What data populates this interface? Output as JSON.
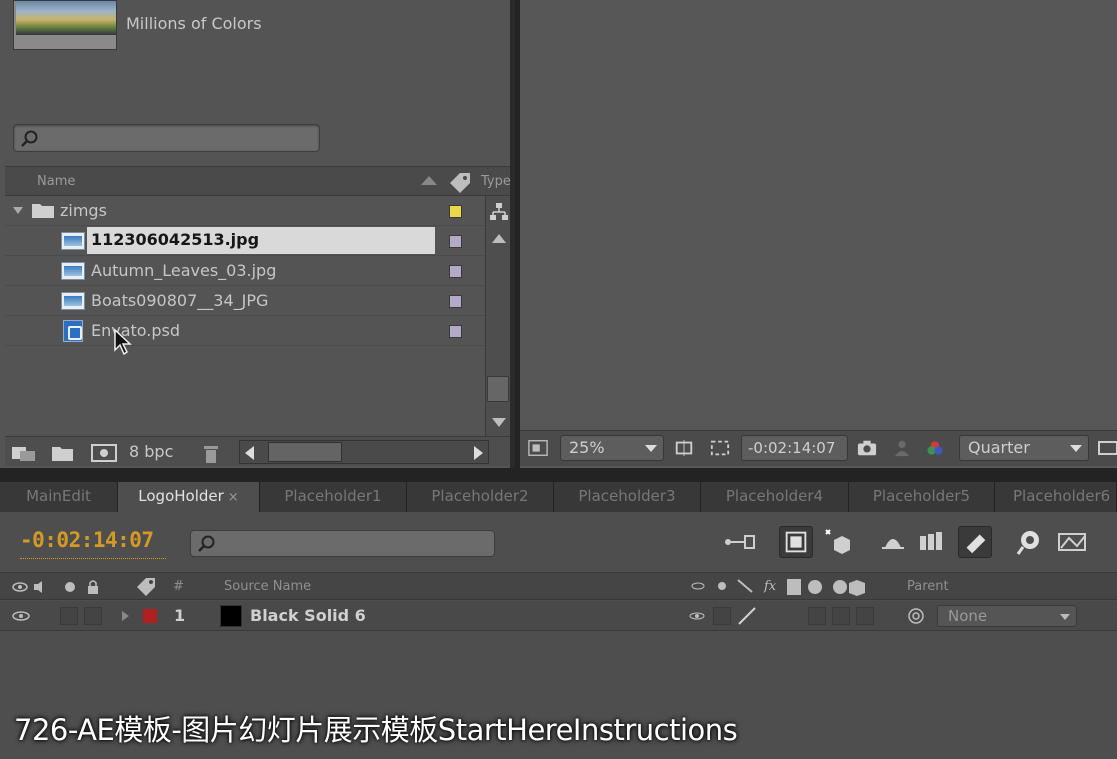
{
  "project": {
    "thumbnail_info": "Millions of Colors",
    "search": {
      "value": "",
      "placeholder": ""
    },
    "columns": {
      "name": "Name",
      "type": "Type"
    },
    "folder": {
      "name": "zimgs",
      "label_color": "#e8d84a"
    },
    "items": [
      {
        "name": "112306042513.jpg",
        "kind": "image",
        "selected": true,
        "label_color": "#b3aac8"
      },
      {
        "name": "Autumn_Leaves_03.jpg",
        "kind": "image",
        "selected": false,
        "label_color": "#b3aac8"
      },
      {
        "name": "Boats090807__34_JPG",
        "kind": "image",
        "selected": false,
        "label_color": "#b3aac8"
      },
      {
        "name": "Envato.psd",
        "kind": "psd",
        "selected": false,
        "label_color": "#b3aac8"
      }
    ],
    "bottom": {
      "bit_depth": "8 bpc"
    }
  },
  "viewer": {
    "zoom": "25%",
    "timecode": "-0:02:14:07",
    "resolution": "Quarter"
  },
  "timeline": {
    "tabs": [
      {
        "label": "MainEdit",
        "active": false
      },
      {
        "label": "LogoHolder",
        "active": true,
        "close": "×"
      },
      {
        "label": "Placeholder1",
        "active": false
      },
      {
        "label": "Placeholder2",
        "active": false
      },
      {
        "label": "Placeholder3",
        "active": false
      },
      {
        "label": "Placeholder4",
        "active": false
      },
      {
        "label": "Placeholder5",
        "active": false
      },
      {
        "label": "Placeholder6",
        "active": false
      }
    ],
    "current_time": "-0:02:14:07",
    "search": {
      "value": "",
      "placeholder": ""
    },
    "headers": {
      "num": "#",
      "source_name": "Source Name",
      "switches": "fx",
      "parent": "Parent"
    },
    "layers": [
      {
        "number": "1",
        "name": "Black Solid 6",
        "label_color": "#b02020",
        "parent": "None"
      }
    ]
  },
  "caption": "726-AE模板-图片幻灯片展示模板StartHereInstructions"
}
